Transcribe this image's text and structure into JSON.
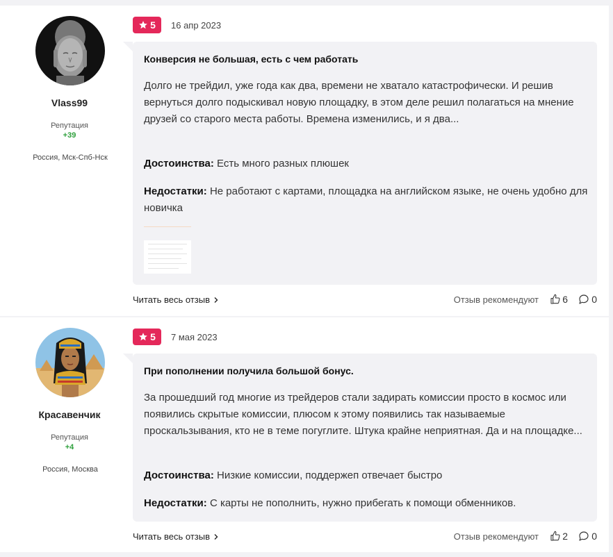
{
  "reviews": [
    {
      "username": "Vlass99",
      "reputation_label": "Репутация",
      "reputation_value": "+39",
      "location": "Россия, Мск-Спб-Нск",
      "rating": "5",
      "date": "16 апр 2023",
      "title": "Конверсия не большая, есть с чем работать",
      "text": "Долго не трейдил, уже года как два, времени не хватало катастрофически. И решив вернуться долго подыскивал новую площадку, в этом деле решил полагаться на мнение друзей со старого места работы. Времена изменились, и я два...",
      "pros_label": "Достоинства:",
      "pros": "Есть много разных плюшек",
      "cons_label": "Недостатки:",
      "cons": "Не работают с картами, площадка на английском языке, не очень удобно для новичка",
      "read_more": "Читать весь отзыв",
      "recommend_label": "Отзыв рекомендуют",
      "likes": "6",
      "comments": "0"
    },
    {
      "username": "Красавенчик",
      "reputation_label": "Репутация",
      "reputation_value": "+4",
      "location": "Россия, Москва",
      "rating": "5",
      "date": "7 мая 2023",
      "title": "При пополнении получила большой бонус.",
      "text": "За прошедший год многие из трейдеров стали задирать комиссии просто в космос или появились скрытые комиссии, плюсом к этому появились так называемые проскальзывания, кто не в теме погуглите. Штука крайне неприятная. Да и на площадке...",
      "pros_label": "Достоинства:",
      "pros": "Низкие комиссии, поддержеп отвечает быстро",
      "cons_label": "Недостатки:",
      "cons": "С карты не пополнить, нужно прибегать к помощи обменников.",
      "read_more": "Читать весь отзыв",
      "recommend_label": "Отзыв рекомендуют",
      "likes": "2",
      "comments": "0"
    }
  ],
  "colors": {
    "rating_badge": "#e4285a",
    "reputation_positive": "#2ea03c",
    "bubble_bg": "#f2f2f5"
  }
}
